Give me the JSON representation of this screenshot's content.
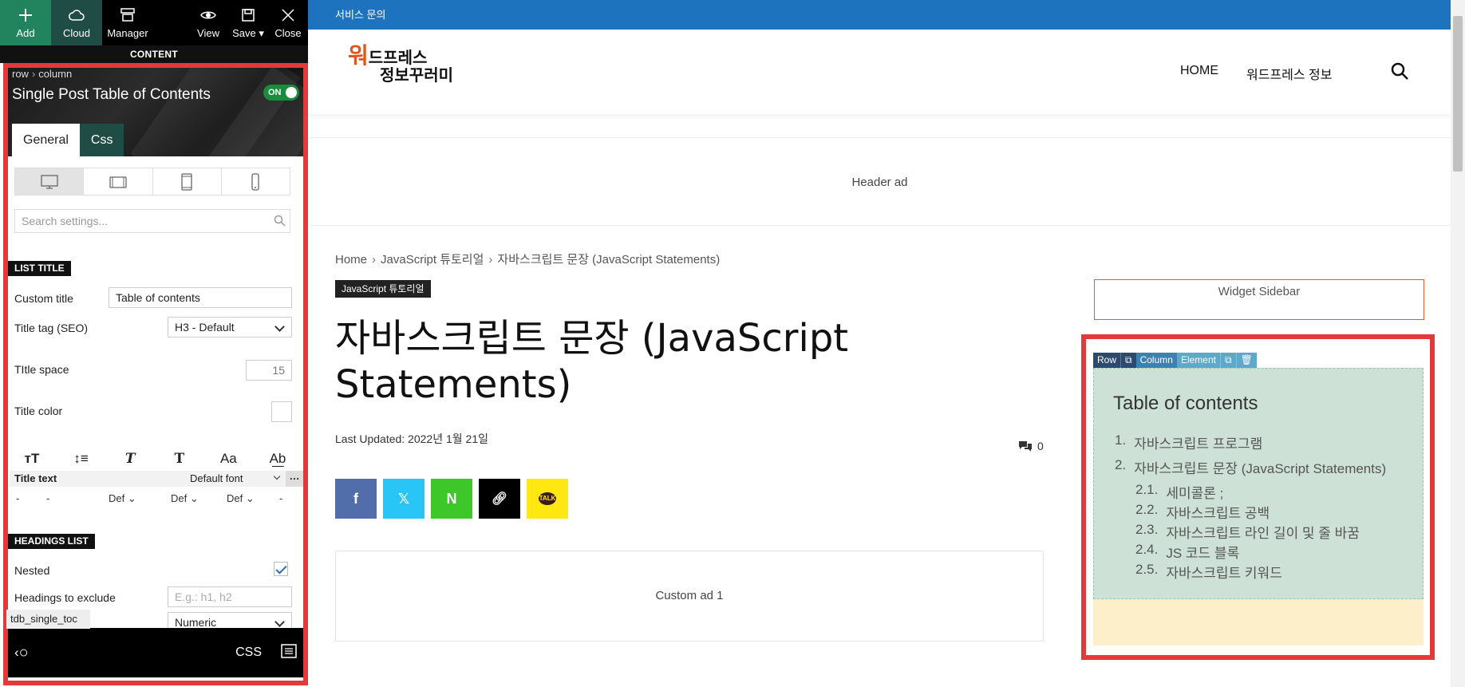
{
  "toolbar": {
    "add": "Add",
    "cloud": "Cloud",
    "manager": "Manager",
    "view": "View",
    "save": "Save",
    "close": "Close",
    "content": "CONTENT"
  },
  "element": {
    "breadcrumb_row": "row",
    "breadcrumb_column": "column",
    "title": "Single Post Table of Contents",
    "toggle": "ON",
    "tabs": [
      "General",
      "Css"
    ]
  },
  "settings": {
    "search_placeholder": "Search settings...",
    "list_title_head": "LIST TITLE",
    "custom_title_label": "Custom title",
    "custom_title_value": "Table of contents",
    "title_tag_label": "Title tag (SEO)",
    "title_tag_value": "H3 - Default",
    "title_space_label": "TItle space",
    "title_space_value": "15",
    "title_color_label": "Title color",
    "title_text_label": "Title text",
    "title_text_font": "Default font",
    "def_values": [
      "-",
      "-",
      "Def",
      "Def",
      "Def",
      "-"
    ],
    "headings_head": "HEADINGS LIST",
    "nested_label": "Nested",
    "exclude_label": "Headings to exclude",
    "exclude_placeholder": "E.g.: h1, h2",
    "numbering_value": "Numeric",
    "shortcode_tag": "tdb_single_toc"
  },
  "bottombar": {
    "css": "CSS"
  },
  "site": {
    "topbar": "서비스 문의",
    "logo_line1": "워드프레스",
    "logo_line2": "정보꾸러미",
    "nav": [
      "HOME",
      "워드프레스 정보"
    ],
    "header_ad": "Header ad",
    "breadcrumb": [
      "Home",
      "JavaScript 튜토리얼",
      "자바스크립트 문장 (JavaScript Statements)"
    ],
    "category": "JavaScript 튜토리얼",
    "post_title": "자바스크립트 문장 (JavaScript Statements)",
    "updated": "Last Updated: 2022년 1월 21일",
    "comments_count": "0",
    "custom_ad": "Custom ad 1",
    "widget_sidebar": "Widget Sidebar"
  },
  "editbar": {
    "row": "Row",
    "column": "Column",
    "element": "Element"
  },
  "toc": {
    "title": "Table of contents",
    "items": [
      {
        "num": "1.",
        "text": "자바스크립트 프로그램"
      },
      {
        "num": "2.",
        "text": "자바스크립트 문장 (JavaScript Statements)"
      }
    ],
    "sub_items": [
      {
        "num": "2.1.",
        "text": "세미콜론 ;"
      },
      {
        "num": "2.2.",
        "text": "자바스크립트 공백"
      },
      {
        "num": "2.3.",
        "text": "자바스크립트 라인 길이 및 줄 바꿈"
      },
      {
        "num": "2.4.",
        "text": "JS 코드 블록"
      },
      {
        "num": "2.5.",
        "text": "자바스크립트 키워드"
      }
    ]
  },
  "colors": {
    "add_green": "#22835f",
    "cloud_teal": "#1f4c45",
    "accent_red": "#e4393c",
    "site_blue": "#1e73be",
    "toc_bg": "#cde1d6"
  }
}
